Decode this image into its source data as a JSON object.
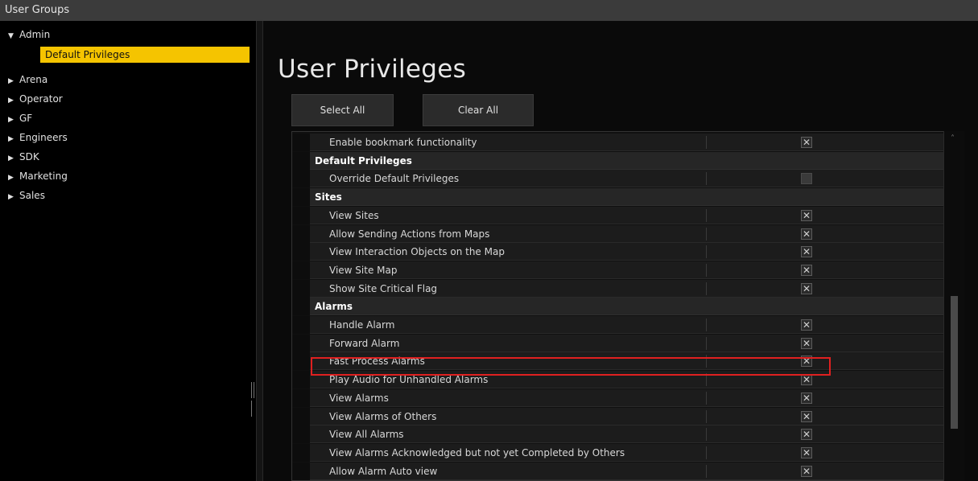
{
  "window": {
    "title": "User Groups"
  },
  "tree": {
    "items": [
      {
        "label": "Admin",
        "expanded": true
      },
      {
        "label": "Arena"
      },
      {
        "label": "Operator"
      },
      {
        "label": "GF"
      },
      {
        "label": "Engineers"
      },
      {
        "label": "SDK"
      },
      {
        "label": "Marketing"
      },
      {
        "label": "Sales"
      }
    ],
    "selected_child": "Default Privileges"
  },
  "main": {
    "title": "User Privileges",
    "select_all_label": "Select All",
    "clear_all_label": "Clear All"
  },
  "privileges": {
    "rows": [
      {
        "type": "item",
        "label": "Enable bookmark functionality",
        "checked": true
      },
      {
        "type": "group",
        "label": "Default Privileges"
      },
      {
        "type": "item",
        "label": "Override Default Privileges",
        "checked": false
      },
      {
        "type": "group",
        "label": "Sites"
      },
      {
        "type": "item",
        "label": "View Sites",
        "checked": true
      },
      {
        "type": "item",
        "label": "Allow Sending Actions from Maps",
        "checked": true
      },
      {
        "type": "item",
        "label": "View Interaction Objects on the Map",
        "checked": true
      },
      {
        "type": "item",
        "label": "View Site Map",
        "checked": true
      },
      {
        "type": "item",
        "label": "Show Site Critical Flag",
        "checked": true
      },
      {
        "type": "group",
        "label": "Alarms"
      },
      {
        "type": "item",
        "label": "Handle Alarm",
        "checked": true
      },
      {
        "type": "item",
        "label": "Forward Alarm",
        "checked": true
      },
      {
        "type": "item",
        "label": "Fast Process Alarms",
        "checked": true,
        "highlighted": true
      },
      {
        "type": "item",
        "label": "Play Audio for Unhandled Alarms",
        "checked": true
      },
      {
        "type": "item",
        "label": "View Alarms",
        "checked": true
      },
      {
        "type": "item",
        "label": "View Alarms of Others",
        "checked": true
      },
      {
        "type": "item",
        "label": "View All Alarms",
        "checked": true
      },
      {
        "type": "item",
        "label": "View Alarms Acknowledged but not yet Completed by Others",
        "checked": true
      },
      {
        "type": "item",
        "label": "Allow Alarm Auto view",
        "checked": true
      }
    ]
  },
  "colors": {
    "selection": "#f5c400",
    "highlight_border": "#e02020"
  },
  "icons": {
    "expanded": "triangle-down-icon",
    "collapsed": "triangle-right-icon",
    "check": "x-check-icon"
  }
}
